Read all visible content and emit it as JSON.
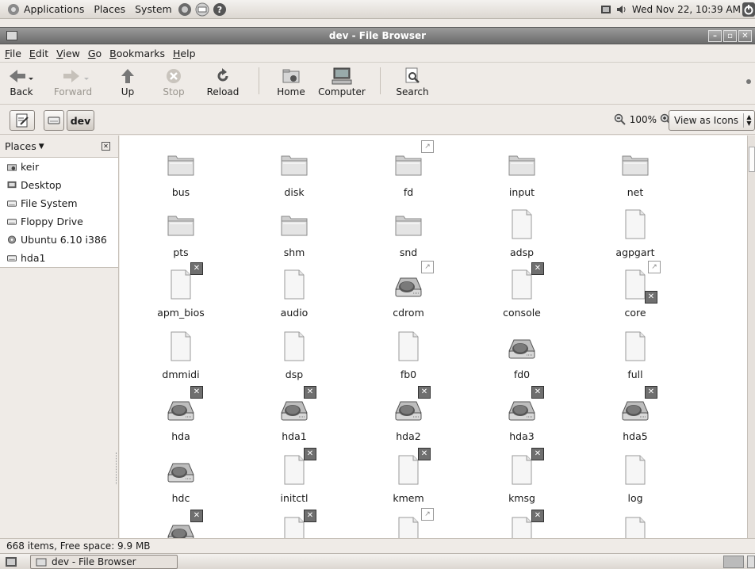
{
  "panel": {
    "applications": "Applications",
    "places": "Places",
    "system": "System",
    "clock": "Wed Nov 22, 10:39 AM"
  },
  "window": {
    "title": "dev - File Browser"
  },
  "menubar": [
    "File",
    "Edit",
    "View",
    "Go",
    "Bookmarks",
    "Help"
  ],
  "toolbar": {
    "back": "Back",
    "forward": "Forward",
    "up": "Up",
    "stop": "Stop",
    "reload": "Reload",
    "home": "Home",
    "computer": "Computer",
    "search": "Search"
  },
  "location": {
    "current": "dev",
    "zoom": "100%",
    "view_mode": "View as Icons"
  },
  "sidebar": {
    "header": "Places",
    "items": [
      {
        "label": "keir",
        "icon": "home-folder-icon"
      },
      {
        "label": "Desktop",
        "icon": "desktop-icon"
      },
      {
        "label": "File System",
        "icon": "drive-icon"
      },
      {
        "label": "Floppy Drive",
        "icon": "floppy-icon"
      },
      {
        "label": "Ubuntu 6.10 i386",
        "icon": "cdrom-icon"
      },
      {
        "label": "hda1",
        "icon": "drive-icon"
      }
    ]
  },
  "files": [
    {
      "name": "bus",
      "kind": "folder"
    },
    {
      "name": "disk",
      "kind": "folder"
    },
    {
      "name": "fd",
      "kind": "folder",
      "badge": "link"
    },
    {
      "name": "input",
      "kind": "folder"
    },
    {
      "name": "net",
      "kind": "folder"
    },
    {
      "name": "pts",
      "kind": "folder"
    },
    {
      "name": "shm",
      "kind": "folder"
    },
    {
      "name": "snd",
      "kind": "folder"
    },
    {
      "name": "adsp",
      "kind": "file"
    },
    {
      "name": "agpgart",
      "kind": "file"
    },
    {
      "name": "apm_bios",
      "kind": "file",
      "badge": "x"
    },
    {
      "name": "audio",
      "kind": "file"
    },
    {
      "name": "cdrom",
      "kind": "drive",
      "badge": "link"
    },
    {
      "name": "console",
      "kind": "file",
      "badge": "x"
    },
    {
      "name": "core",
      "kind": "file",
      "badge": "link",
      "badge2": "x"
    },
    {
      "name": "dmmidi",
      "kind": "file"
    },
    {
      "name": "dsp",
      "kind": "file"
    },
    {
      "name": "fb0",
      "kind": "file"
    },
    {
      "name": "fd0",
      "kind": "drive"
    },
    {
      "name": "full",
      "kind": "file"
    },
    {
      "name": "hda",
      "kind": "drive",
      "badge": "x"
    },
    {
      "name": "hda1",
      "kind": "drive",
      "badge": "x"
    },
    {
      "name": "hda2",
      "kind": "drive",
      "badge": "x"
    },
    {
      "name": "hda3",
      "kind": "drive",
      "badge": "x"
    },
    {
      "name": "hda5",
      "kind": "drive",
      "badge": "x"
    },
    {
      "name": "hdc",
      "kind": "drive"
    },
    {
      "name": "initctl",
      "kind": "file",
      "badge": "x"
    },
    {
      "name": "kmem",
      "kind": "file",
      "badge": "x"
    },
    {
      "name": "kmsg",
      "kind": "file",
      "badge": "x"
    },
    {
      "name": "log",
      "kind": "file"
    },
    {
      "name": "",
      "kind": "drive",
      "badge": "x"
    },
    {
      "name": "",
      "kind": "file",
      "badge": "x"
    },
    {
      "name": "",
      "kind": "file",
      "badge": "link"
    },
    {
      "name": "",
      "kind": "file",
      "badge": "x"
    },
    {
      "name": "",
      "kind": "file"
    }
  ],
  "status": {
    "text": "668 items, Free space: 9.9 MB"
  },
  "taskbar": {
    "task": "dev - File Browser"
  }
}
